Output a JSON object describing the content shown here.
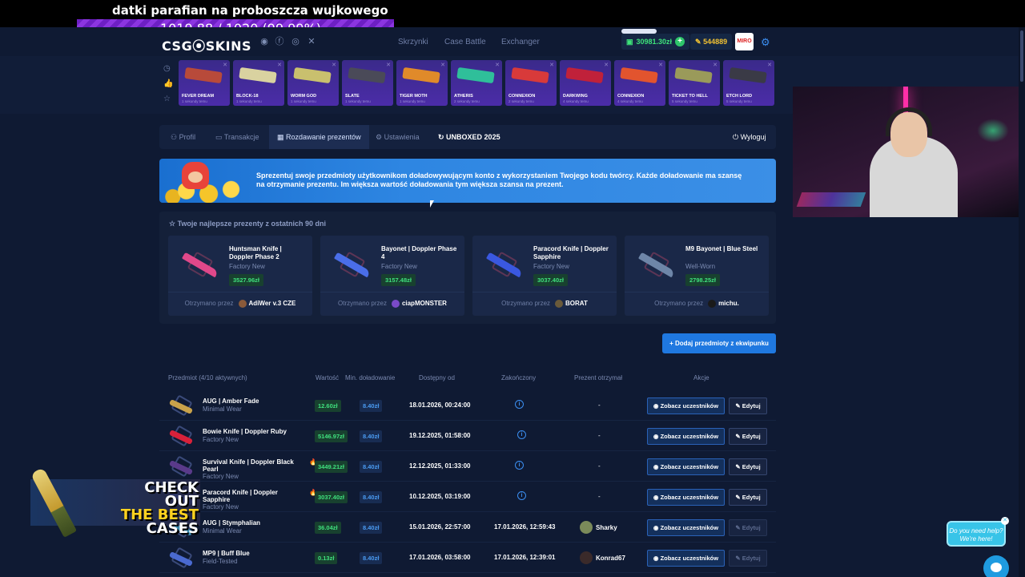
{
  "stream": {
    "title": "datki parafian na proboszcza wujkowego",
    "goal": "1019.88 / 1020 (99.99%)"
  },
  "header": {
    "logo": "CSG⦿SKINS",
    "nav": [
      "Skrzynki",
      "Case Battle",
      "Exchanger"
    ],
    "balance": "30981.30zł",
    "coins": "544889",
    "avatar_text": "MIRO"
  },
  "drops": [
    {
      "name": "FEVER DREAM",
      "sub": "1 sekundy temu",
      "color": "#b84a3a"
    },
    {
      "name": "BLOCK-18",
      "sub": "1 sekundy temu",
      "color": "#d9d2a0"
    },
    {
      "name": "WORM GOD",
      "sub": "1 sekundy temu",
      "color": "#c9c06e"
    },
    {
      "name": "SLATE",
      "sub": "1 sekundy temu",
      "color": "#4a4a58"
    },
    {
      "name": "TIGER MOTH",
      "sub": "1 sekundy temu",
      "color": "#e08a2a"
    },
    {
      "name": "ATHERIS",
      "sub": "2 sekundy temu",
      "color": "#2fbf9a"
    },
    {
      "name": "CONNEXION",
      "sub": "2 sekundy temu",
      "color": "#d83a3a"
    },
    {
      "name": "DARKWING",
      "sub": "4 sekundy temu",
      "color": "#c0213a"
    },
    {
      "name": "CONNEXION",
      "sub": "4 sekundy temu",
      "color": "#e2542e"
    },
    {
      "name": "TICKET TO HELL",
      "sub": "5 sekundy temu",
      "color": "#9a9a5a"
    },
    {
      "name": "ETCH LORD",
      "sub": "5 sekundy temu",
      "color": "#3a3a46"
    }
  ],
  "tabs": {
    "profil": "Profil",
    "transakcje": "Transakcje",
    "rozdawanie": "Rozdawanie prezentów",
    "ustawienia": "Ustawienia",
    "unboxed": "UNBOXED 2025",
    "logout": "Wyloguj"
  },
  "banner": {
    "text": "Sprezentuj swoje przedmioty użytkownikom doładowywującym konto z wykorzystaniem Twojego kodu twórcy. Każde doładowanie ma szansę na otrzymanie prezentu. Im większa wartość doładowania tym większa szansa na prezent."
  },
  "best": {
    "title": "Twoje najlepsze prezenty z ostatnich 90 dni",
    "received_label": "Otrzymano przez",
    "items": [
      {
        "name": "Huntsman Knife | Doppler Phase 2",
        "cond": "Factory New",
        "price": "3527.96zł",
        "user": "AdiWer v.3 CZE",
        "color": "#e0488a"
      },
      {
        "name": "Bayonet | Doppler Phase 4",
        "cond": "Factory New",
        "price": "3157.48zł",
        "user": "ciapMONSTER",
        "color": "#4a6ee8"
      },
      {
        "name": "Paracord Knife | Doppler Sapphire",
        "cond": "Factory New",
        "price": "3037.40zł",
        "user": "BORAT",
        "color": "#3a58e0"
      },
      {
        "name": "M9 Bayonet | Blue Steel",
        "cond": "Well-Worn",
        "price": "2798.25zł",
        "user": "michu.",
        "color": "#6e86a8"
      }
    ]
  },
  "add_button": "Dodaj przedmioty z ekwipunku",
  "table": {
    "headers": {
      "item": "Przedmiot (4/10 aktywnych)",
      "value": "Wartość",
      "min": "Min. doładowanie",
      "avail": "Dostępny od",
      "ended": "Zakończony",
      "winner": "Prezent otrzymał",
      "actions": "Akcje"
    },
    "view_label": "Zobacz uczestników",
    "edit_label": "Edytuj",
    "rows": [
      {
        "name": "AUG | Amber Fade",
        "cond": "Minimal Wear",
        "value": "12.60zł",
        "min": "8.40zł",
        "avail": "18.01.2026, 00:24:00",
        "ended": "",
        "winner": "-",
        "color": "#c9a24a"
      },
      {
        "name": "Bowie Knife | Doppler Ruby",
        "cond": "Factory New",
        "value": "5146.97zł",
        "min": "8.40zł",
        "avail": "19.12.2025, 01:58:00",
        "ended": "",
        "winner": "-",
        "color": "#d8213a"
      },
      {
        "name": "Survival Knife | Doppler Black Pearl",
        "cond": "Factory New",
        "value": "3449.21zł",
        "min": "8.40zł",
        "avail": "12.12.2025, 01:33:00",
        "ended": "",
        "winner": "-",
        "color": "#5a3a8a"
      },
      {
        "name": "Paracord Knife | Doppler Sapphire",
        "cond": "Factory New",
        "value": "3037.40zł",
        "min": "8.40zł",
        "avail": "10.12.2025, 03:19:00",
        "ended": "",
        "winner": "-",
        "color": "#3a58e0"
      },
      {
        "name": "AUG | Stymphalian",
        "cond": "Minimal Wear",
        "value": "36.04zł",
        "min": "8.40zł",
        "avail": "15.01.2026, 22:57:00",
        "ended": "17.01.2026, 12:59:43",
        "winner": "Sharky",
        "color": "#3a8ab0"
      },
      {
        "name": "MP9 | Buff Blue",
        "cond": "Field-Tested",
        "value": "0.13zł",
        "min": "8.40zł",
        "avail": "17.01.2026, 03:58:00",
        "ended": "17.01.2026, 12:39:01",
        "winner": "Konrad67",
        "color": "#4a6ad0"
      }
    ]
  },
  "promo": {
    "line1": "CHECK OUT",
    "line2": "THE BEST",
    "line3": "CASES"
  },
  "help": {
    "text": "Do you need help? We're here!"
  }
}
